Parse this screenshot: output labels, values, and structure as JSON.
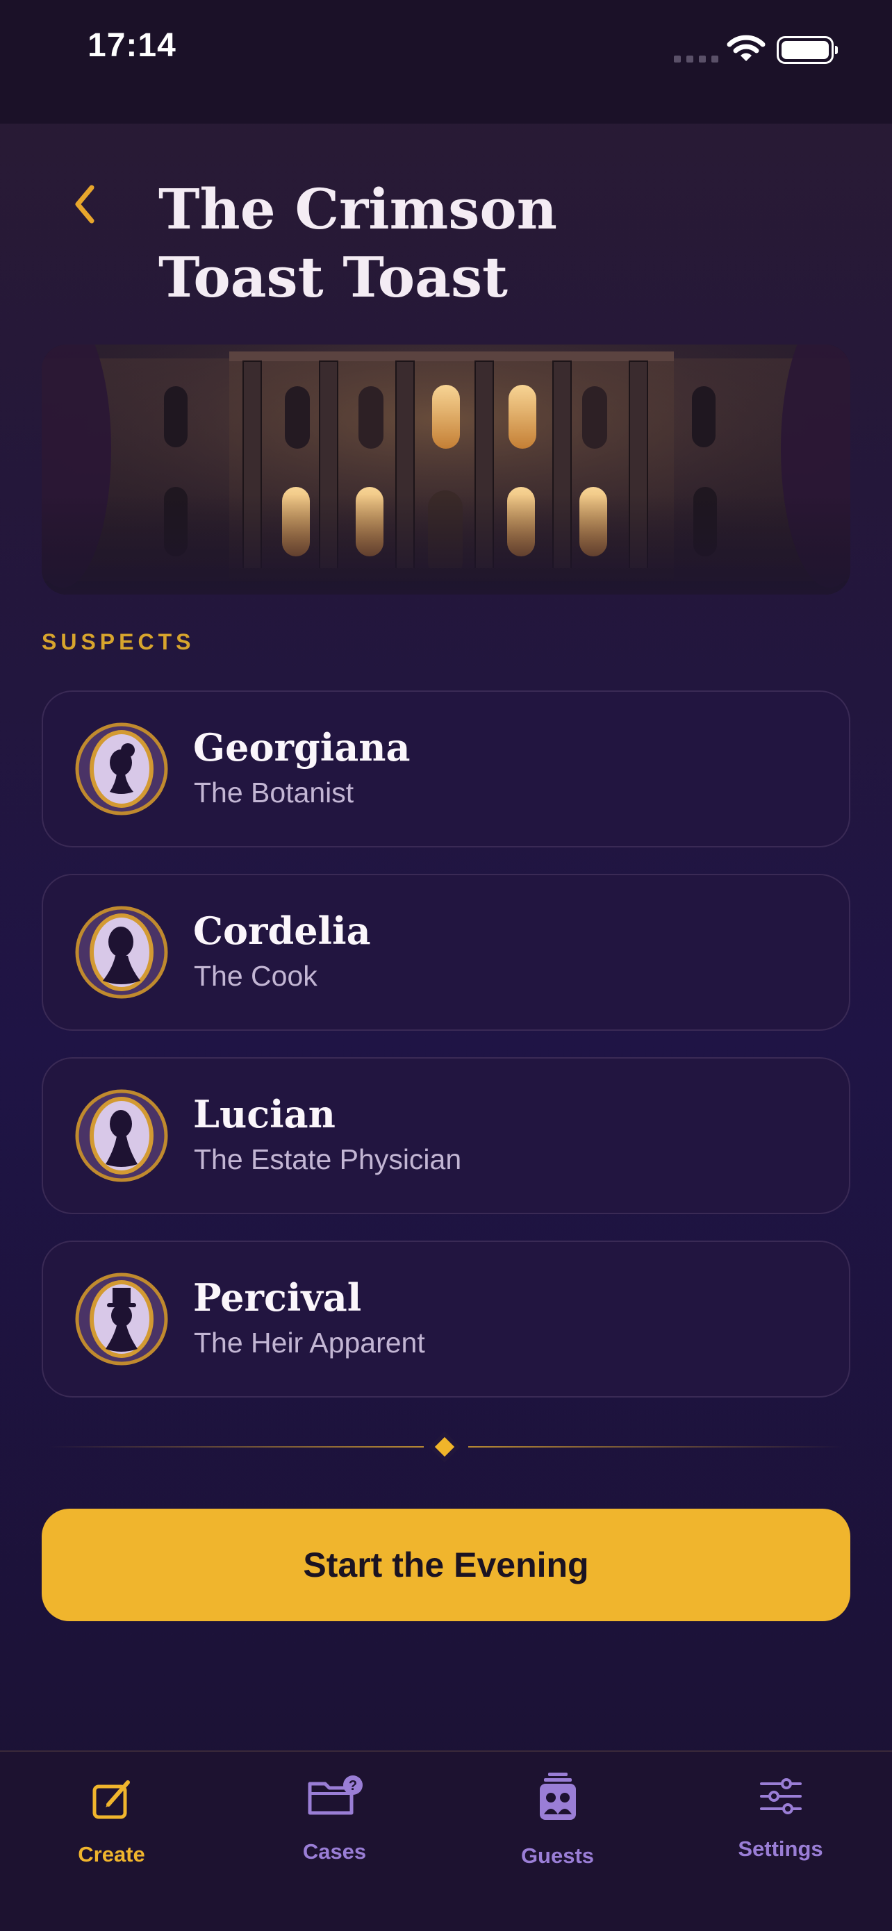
{
  "status_bar": {
    "time": "17:14"
  },
  "header": {
    "title_line1": "The Crimson",
    "title_line2": "Toast Toast"
  },
  "section": {
    "label": "SUSPECTS"
  },
  "suspects": [
    {
      "name": "Georgiana",
      "role": "The Botanist"
    },
    {
      "name": "Cordelia",
      "role": "The Cook"
    },
    {
      "name": "Lucian",
      "role": "The Estate Physician"
    },
    {
      "name": "Percival",
      "role": "The Heir Apparent"
    }
  ],
  "cta": {
    "label": "Start the Evening"
  },
  "tabs": [
    {
      "label": "Create",
      "active": true
    },
    {
      "label": "Cases",
      "active": false
    },
    {
      "label": "Guests",
      "active": false
    },
    {
      "label": "Settings",
      "active": false
    }
  ],
  "colors": {
    "accent": "#f0b52d",
    "inactive_tab": "#9a7ed6",
    "card_bg": "#221540"
  }
}
